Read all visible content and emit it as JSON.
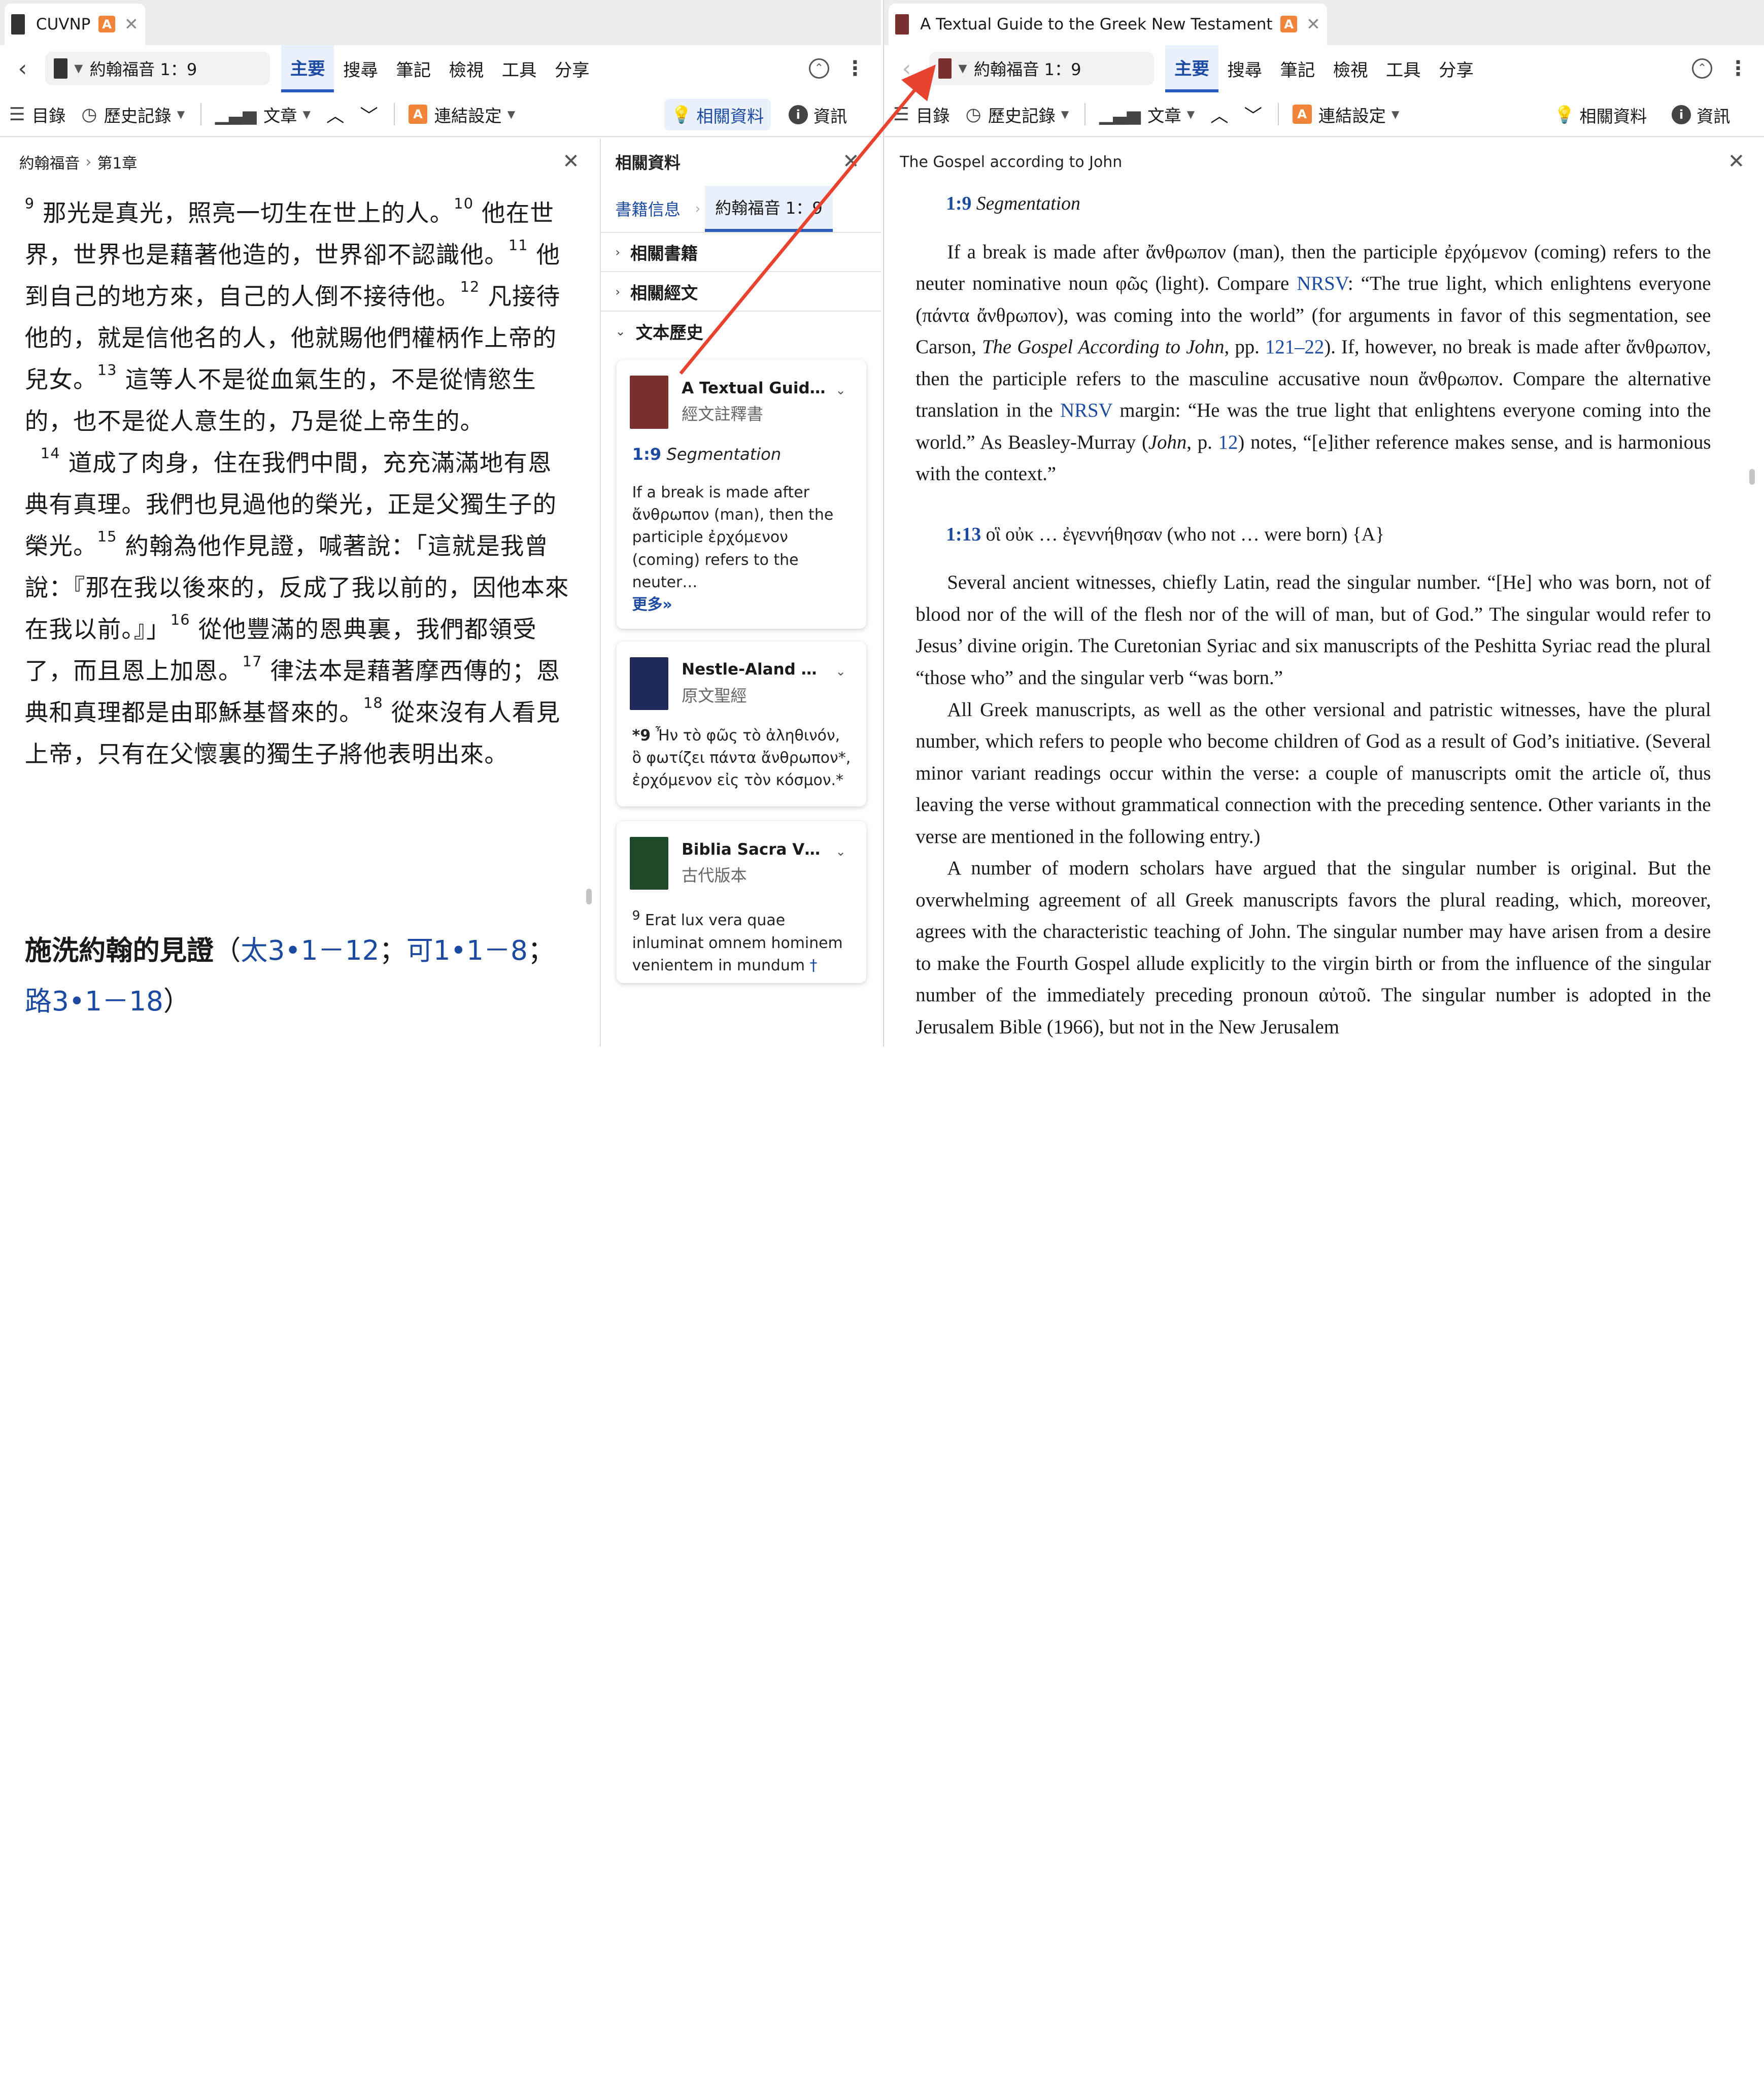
{
  "left_tab": {
    "title": "CUVNP",
    "badge": "A"
  },
  "right_tab": {
    "title": "A Textual Guide to the Greek New Testament",
    "badge": "A"
  },
  "nav": {
    "reference": "約翰福音 1：9",
    "menu": [
      "主要",
      "搜尋",
      "筆記",
      "檢視",
      "工具",
      "分享"
    ]
  },
  "toolbar": {
    "toc": "目錄",
    "history": "歷史記錄",
    "article": "文章",
    "link_settings": "連結設定",
    "related": "相關資料",
    "info": "資訊"
  },
  "left_header": {
    "book": "約翰福音",
    "sep": "›",
    "chapter": "第1章"
  },
  "related": {
    "title": "相關資料",
    "tab_info": "書籍信息",
    "tab_ref": "約翰福音 1：9",
    "sections": [
      "相關書籍",
      "相關經文",
      "文本歷史"
    ],
    "cards": [
      {
        "title": "A Textual Guid…",
        "subtitle": "經文註釋書",
        "verse": "1:9",
        "heading": "Segmentation",
        "body": "If a break is made after ἄνθρωπον (man), then the participle ἐρχόμενον (coming) refers to the neuter…",
        "more": "更多»",
        "color": "#7a2f2f"
      },
      {
        "title": "Nestle-Aland …",
        "subtitle": "原文聖經",
        "verse": "*9",
        "body": "Ἦν τὸ φῶς τὸ ἀληθινόν, ὃ φωτίζει πάντα ἄνθρωπον*, ἐρχόμενον εἰς τὸν κόσμον.*",
        "color": "#1f2a5a"
      },
      {
        "title": "Biblia Sacra V…",
        "subtitle": "古代版本",
        "verse": "9",
        "body": "Erat lux vera quae inluminat omnem hominem venientem in mundum",
        "dagger": "†",
        "color": "#1e4a2a"
      }
    ]
  },
  "chinese_text": {
    "p1": [
      {
        "v": "9",
        "t": "那光是真光，照亮一切生在世上的人。"
      },
      {
        "v": "10",
        "t": "他在世界，世界也是藉著他造的，世界卻不認識他。"
      },
      {
        "v": "11",
        "t": "他到自己的地方來，自己的人倒不接待他。"
      },
      {
        "v": "12",
        "t": "凡接待他的，就是信他名的人，他就賜他們權柄作上帝的兒女。"
      },
      {
        "v": "13",
        "t": "這等人不是從血氣生的，不是從情慾生的，也不是從人意生的，乃是從上帝生的。"
      }
    ],
    "p2": [
      {
        "v": "14",
        "t": "道成了肉身，住在我們中間，充充滿滿地有恩典有真理。我們也見過他的榮光，正是父獨生子的榮光。"
      },
      {
        "v": "15",
        "t": "約翰為他作見證，喊著說：「這就是我曾說：『那在我以後來的，反成了我以前的，因他本來在我以前。』」"
      },
      {
        "v": "16",
        "t": "從他豐滿的恩典裏，我們都領受了，而且恩上加恩。"
      },
      {
        "v": "17",
        "t": "律法本是藉著摩西傳的；恩典和真理都是由耶穌基督來的。"
      },
      {
        "v": "18",
        "t": "從來沒有人看見上帝，只有在父懷裏的獨生子將他表明出來。"
      }
    ],
    "heading": "施洗約翰的見證",
    "open": "（",
    "ref1": "太3•1－12",
    "semi1": "；",
    "ref2": "可1•1－8",
    "semi2": "；",
    "ref3": "路3•1－18",
    "close": "）"
  },
  "guide": {
    "header": "The Gospel according to John",
    "h1_verse": "1:9",
    "h1_title": "Segmentation",
    "p1_a": "If a break is made after ἄνθρωπον (man), then the participle ἐρχόμενον (coming) refers to the neuter nominative noun φῶς (light). Compare ",
    "nrsv": "NRSV",
    "p1_b": ": “The true light, which enlightens everyone (πάντα ἄνθρωπον), was coming into the world” (for arguments in favor of this segmentation, see Carson, ",
    "p1_book": "The Gospel According to John",
    "p1_c": ", pp. ",
    "p1_pages": "121–22",
    "p1_d": "). If, however, no break is made after ἄνθρωπον, then the participle refers to the masculine accusative noun ἄνθρωπον. Compare the alternative translation in the ",
    "p1_e": " margin: “He was the true light that enlightens everyone coming into the world.” As Beasley-Murray (",
    "p1_john": "John",
    "p1_f": ", p. ",
    "p1_page": "12",
    "p1_g": ") notes, “[e]ither reference makes sense, and is harmonious with the context.”",
    "h2_verse": "1:13",
    "h2_title": "οἳ οὐκ … ἐγεννήθησαν (who not … were born) {A}",
    "p2": "Several ancient witnesses, chiefly Latin, read the singular number. “[He] who was born, not of blood nor of the will of the flesh nor of the will of man, but of God.” The singular would refer to Jesus’ divine origin. The Curetonian Syriac and six manuscripts of the Peshitta Syriac read the plural “those who” and the singular verb “was born.”",
    "p3": "All Greek manuscripts, as well as the other versional and patristic witnesses, have the plural number, which refers to people who become children of God as a result of God’s initiative. (Several minor variant readings occur within the verse: a couple of manuscripts omit the article οἵ, thus leaving the verse without grammatical connection with the preceding sentence. Other variants in the verse are mentioned in the following entry.)",
    "p4": "A number of modern scholars have argued that the singular number is original. But the overwhelming agreement of all Greek manuscripts favors the plural reading, which, moreover, agrees with the characteristic teaching of John. The singular number may have arisen from a desire to make the Fourth Gospel allude explicitly to the virgin birth or from the influence of the singular number of the immediately preceding pronoun αὐτοῦ. The singular number is adopted in the Jerusalem Bible (1966), but not in the New Jerusalem"
  },
  "colors": {
    "accent": "#1b4aa0",
    "badge": "#f0853a",
    "arrow": "#e8432f"
  }
}
